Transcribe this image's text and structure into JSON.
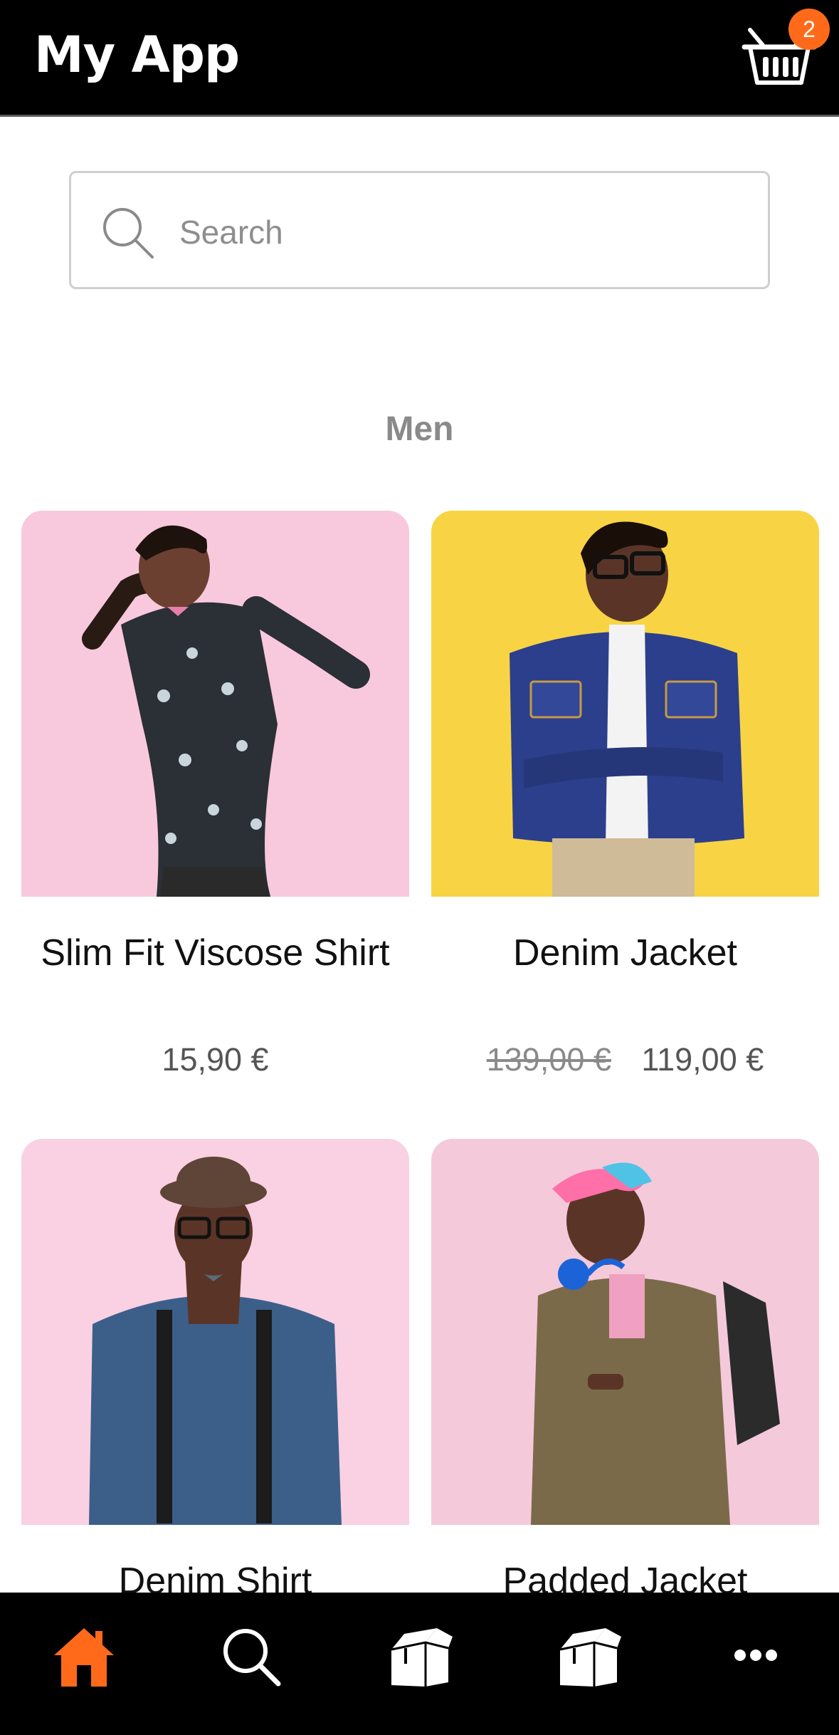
{
  "colors": {
    "accent": "#ff6a1a",
    "header_bg": "#000000",
    "nav_bg": "#000000"
  },
  "header": {
    "title": "My App",
    "cart_icon": "basket-icon",
    "cart_count": "2"
  },
  "search": {
    "placeholder": "Search",
    "value": ""
  },
  "category": {
    "title": "Men"
  },
  "products": [
    {
      "name": "Slim Fit Viscose Shirt",
      "price": "15,90 €",
      "old_price": "",
      "image": "man-floral-shirt-photo"
    },
    {
      "name": "Denim Jacket",
      "price": "119,00 €",
      "old_price": "139,00 €",
      "image": "man-denim-jacket-photo"
    },
    {
      "name": "Denim Shirt",
      "price": "",
      "old_price": "",
      "image": "man-suspenders-photo"
    },
    {
      "name": "Padded Jacket",
      "price": "",
      "old_price": "",
      "image": "man-backpack-photo"
    }
  ],
  "nav": {
    "items": [
      {
        "icon": "home-icon",
        "active": true
      },
      {
        "icon": "search-icon",
        "active": false
      },
      {
        "icon": "box-icon",
        "active": false
      },
      {
        "icon": "box-icon",
        "active": false
      },
      {
        "icon": "more-icon",
        "active": false
      }
    ]
  }
}
